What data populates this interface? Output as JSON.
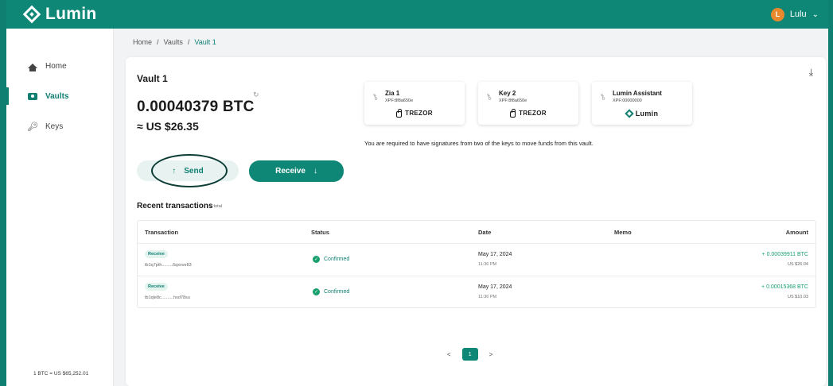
{
  "app": {
    "name": "Lumin"
  },
  "user": {
    "initial": "L",
    "name": "Lulu"
  },
  "sidebar": {
    "items": [
      {
        "label": "Home",
        "icon": "home-icon"
      },
      {
        "label": "Vaults",
        "icon": "vault-icon"
      },
      {
        "label": "Keys",
        "icon": "key-icon"
      }
    ],
    "rate": "1 BTC = US $65,252.01"
  },
  "breadcrumb": {
    "home": "Home",
    "sep": "/",
    "vaults": "Vaults",
    "current": "Vault 1"
  },
  "vault": {
    "title": "Vault 1",
    "balance_btc": "0.00040379 BTC",
    "balance_usd": "≈ US $26.35",
    "requirement": "You are required to have signatures from two of the keys to move funds from this vault."
  },
  "keys": [
    {
      "name": "Zia 1",
      "xpf": "XPF:8f8a650e",
      "brand": "TREZOR"
    },
    {
      "name": "Key 2",
      "xpf": "XPF:8f8a650e",
      "brand": "TREZOR"
    },
    {
      "name": "Lumin Assistant",
      "xpf": "XPF:00000000",
      "brand": "Lumin"
    }
  ],
  "actions": {
    "send": "Send",
    "receive": "Receive"
  },
  "recent": {
    "title": "Recent transactions",
    "count": "3 total"
  },
  "table": {
    "headers": {
      "transaction": "Transaction",
      "status": "Status",
      "date": "Date",
      "memo": "Memo",
      "amount": "Amount"
    },
    "rows": [
      {
        "type": "Receive",
        "txid": "tb1q7pth.........6qxxve83",
        "status": "Confirmed",
        "date": "May 17, 2024",
        "time": "11:36 PM",
        "amount": "+ 0.00039911 BTC",
        "amount_usd": "US $26.04"
      },
      {
        "type": "Receive",
        "txid": "tb1qle8c..........hsd78su",
        "status": "Confirmed",
        "date": "May 17, 2024",
        "time": "11:36 PM",
        "amount": "+ 0.00015368 BTC",
        "amount_usd": "US $10.03"
      }
    ]
  },
  "pagination": {
    "prev": "<",
    "page": "1",
    "next": ">"
  },
  "colors": {
    "brand": "#0f8777",
    "positive": "#18a06e"
  }
}
